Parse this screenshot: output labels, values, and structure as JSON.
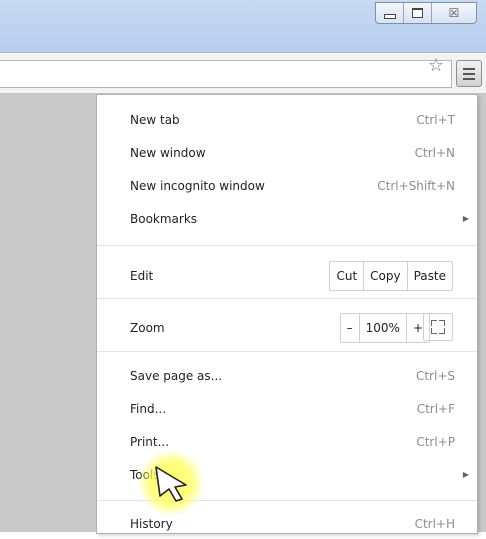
{
  "window": {
    "controls": {
      "minimize_icon": "minimize-icon",
      "maximize_icon": "maximize-icon",
      "close_icon": "close-icon",
      "close_glyph": "☒"
    }
  },
  "toolbar": {
    "omnibox_value": "",
    "bookmark_icon": "star-icon",
    "star_glyph": "☆",
    "menu_icon": "hamburger-icon"
  },
  "menu": {
    "new_tab": {
      "label": "New tab",
      "shortcut": "Ctrl+T"
    },
    "new_window": {
      "label": "New window",
      "shortcut": "Ctrl+N"
    },
    "new_incognito": {
      "label": "New incognito window",
      "shortcut": "Ctrl+Shift+N"
    },
    "bookmarks": {
      "label": "Bookmarks",
      "arrow": "▶"
    },
    "edit": {
      "label": "Edit",
      "cut": "Cut",
      "copy": "Copy",
      "paste": "Paste"
    },
    "zoom": {
      "label": "Zoom",
      "minus": "–",
      "value": "100%",
      "plus": "+"
    },
    "save_page": {
      "label": "Save page as...",
      "shortcut": "Ctrl+S"
    },
    "find": {
      "label": "Find...",
      "shortcut": "Ctrl+F"
    },
    "print": {
      "label": "Print...",
      "shortcut": "Ctrl+P"
    },
    "tools": {
      "label": "Tools",
      "arrow": "▶"
    },
    "history": {
      "label": "History",
      "shortcut": "Ctrl+H"
    }
  },
  "colors": {
    "titlebar": "#c8daf2",
    "cursor_highlight": "#ffff5a"
  }
}
